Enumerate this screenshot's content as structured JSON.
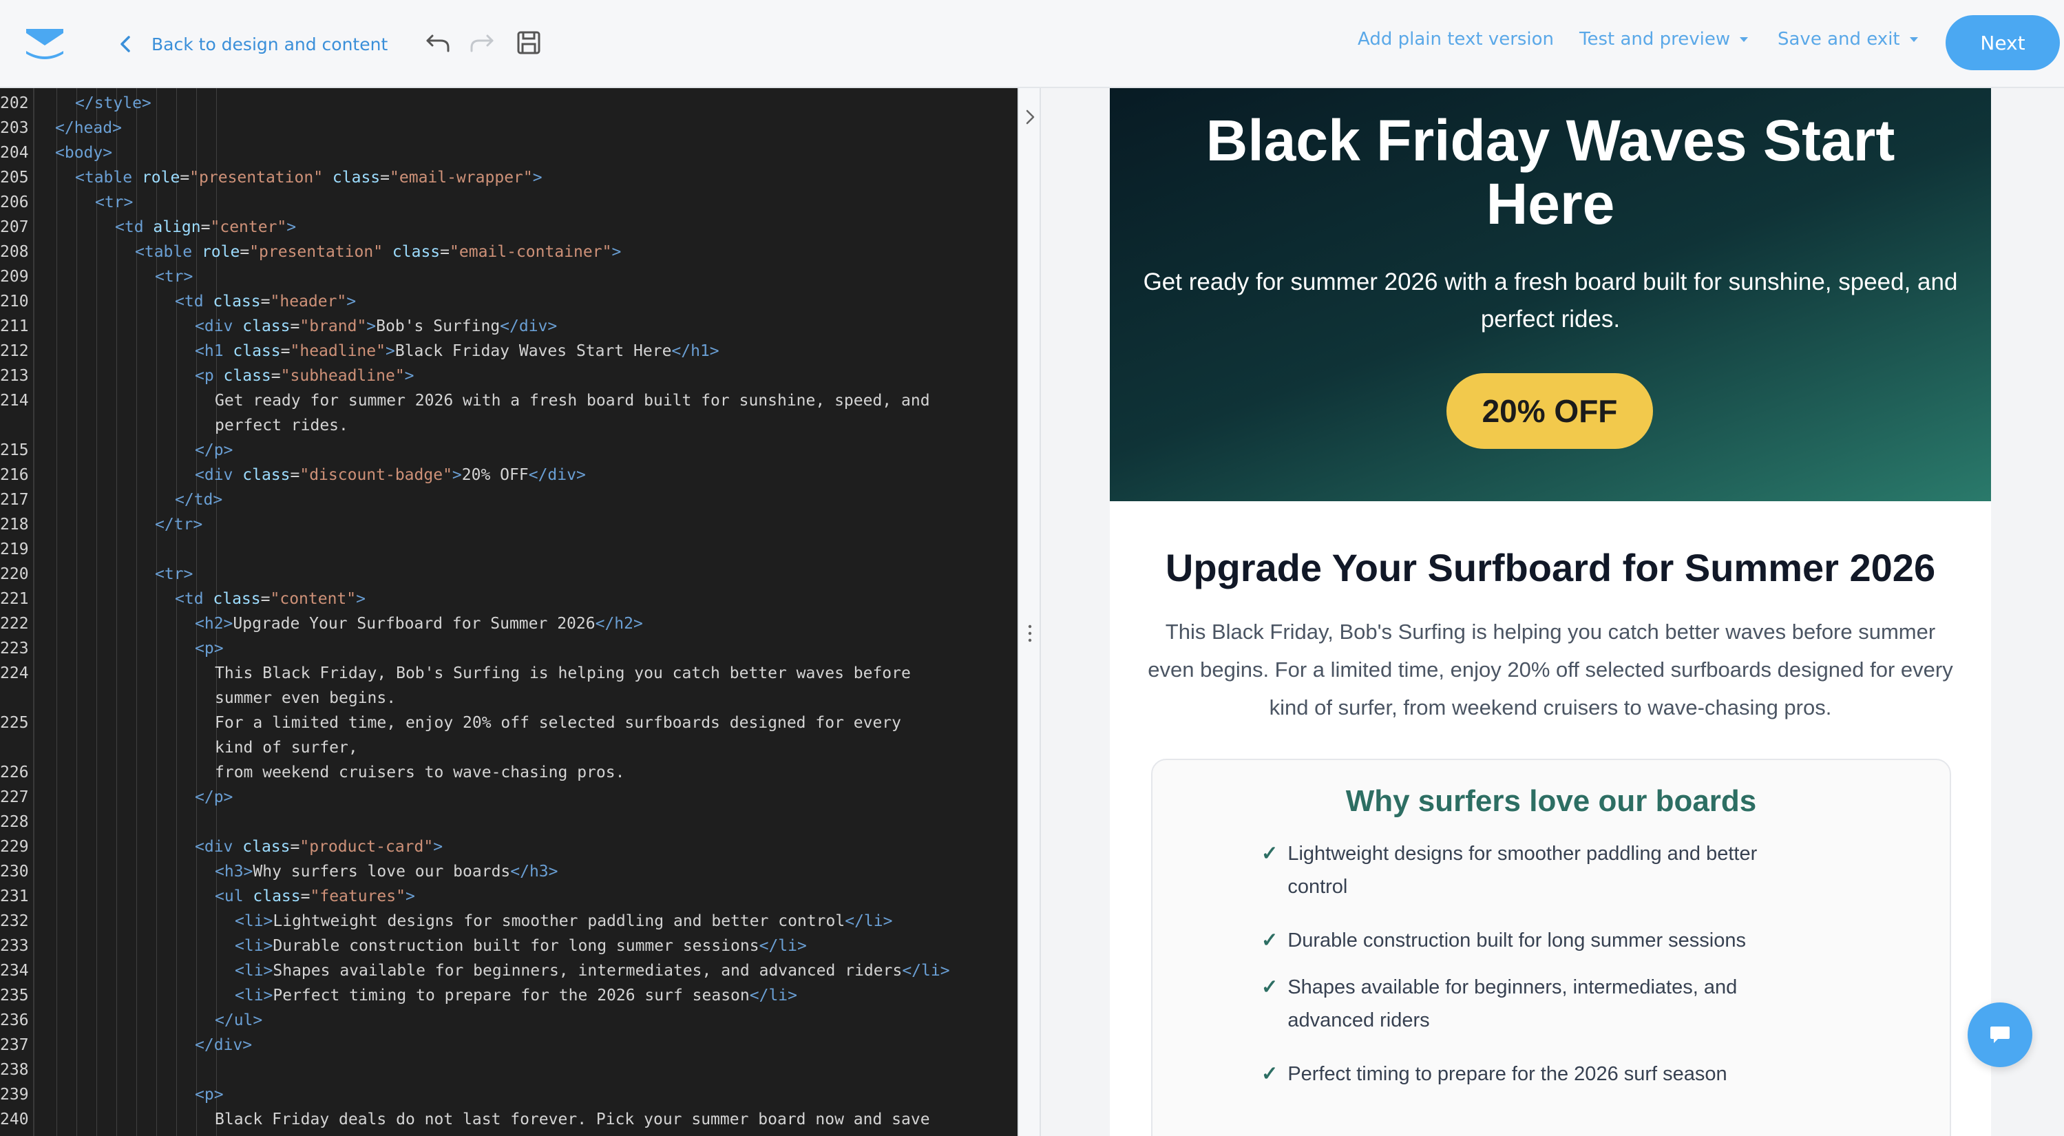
{
  "topbar": {
    "back_label": "Back to design and content",
    "add_plain_text": "Add plain text version",
    "test_preview": "Test and preview",
    "save_exit": "Save and exit",
    "next": "Next"
  },
  "icons": {
    "logo": "envelope-logo-icon",
    "back": "chevron-left-icon",
    "undo": "undo-icon",
    "redo": "redo-icon",
    "save": "save-icon",
    "collapse": "chevron-right-icon",
    "drag": "drag-handle-icon",
    "chat": "chat-icon"
  },
  "colors": {
    "accent": "#4ba8f2",
    "link": "#3a8fd9",
    "badge": "#f2c94c",
    "card_heading": "#2d6e63",
    "editor_bg": "#1e1e1e"
  },
  "editor": {
    "lines": [
      {
        "n": "202",
        "indent": 1,
        "parts": [
          [
            "t",
            "</style>"
          ]
        ]
      },
      {
        "n": "203",
        "indent": 0,
        "parts": [
          [
            "t",
            "</head>"
          ]
        ]
      },
      {
        "n": "204",
        "indent": 0,
        "parts": [
          [
            "t",
            "<body>"
          ]
        ]
      },
      {
        "n": "205",
        "indent": 1,
        "parts": [
          [
            "t",
            "<table "
          ],
          [
            "a",
            "role"
          ],
          [
            "x",
            "="
          ],
          [
            "s",
            "\"presentation\""
          ],
          [
            "x",
            " "
          ],
          [
            "a",
            "class"
          ],
          [
            "x",
            "="
          ],
          [
            "s",
            "\"email-wrapper\""
          ],
          [
            "t",
            ">"
          ]
        ]
      },
      {
        "n": "206",
        "indent": 2,
        "parts": [
          [
            "t",
            "<tr>"
          ]
        ]
      },
      {
        "n": "207",
        "indent": 3,
        "parts": [
          [
            "t",
            "<td "
          ],
          [
            "a",
            "align"
          ],
          [
            "x",
            "="
          ],
          [
            "s",
            "\"center\""
          ],
          [
            "t",
            ">"
          ]
        ]
      },
      {
        "n": "208",
        "indent": 4,
        "parts": [
          [
            "t",
            "<table "
          ],
          [
            "a",
            "role"
          ],
          [
            "x",
            "="
          ],
          [
            "s",
            "\"presentation\""
          ],
          [
            "x",
            " "
          ],
          [
            "a",
            "class"
          ],
          [
            "x",
            "="
          ],
          [
            "s",
            "\"email-container\""
          ],
          [
            "t",
            ">"
          ]
        ]
      },
      {
        "n": "209",
        "indent": 5,
        "parts": [
          [
            "t",
            "<tr>"
          ]
        ]
      },
      {
        "n": "210",
        "indent": 6,
        "parts": [
          [
            "t",
            "<td "
          ],
          [
            "a",
            "class"
          ],
          [
            "x",
            "="
          ],
          [
            "s",
            "\"header\""
          ],
          [
            "t",
            ">"
          ]
        ]
      },
      {
        "n": "211",
        "indent": 7,
        "parts": [
          [
            "t",
            "<div "
          ],
          [
            "a",
            "class"
          ],
          [
            "x",
            "="
          ],
          [
            "s",
            "\"brand\""
          ],
          [
            "t",
            ">"
          ],
          [
            "x",
            "Bob's Surfing"
          ],
          [
            "t",
            "</div>"
          ]
        ]
      },
      {
        "n": "212",
        "indent": 7,
        "parts": [
          [
            "t",
            "<h1 "
          ],
          [
            "a",
            "class"
          ],
          [
            "x",
            "="
          ],
          [
            "s",
            "\"headline\""
          ],
          [
            "t",
            ">"
          ],
          [
            "x",
            "Black Friday Waves Start Here"
          ],
          [
            "t",
            "</h1>"
          ]
        ]
      },
      {
        "n": "213",
        "indent": 7,
        "parts": [
          [
            "t",
            "<p "
          ],
          [
            "a",
            "class"
          ],
          [
            "x",
            "="
          ],
          [
            "s",
            "\"subheadline\""
          ],
          [
            "t",
            ">"
          ]
        ]
      },
      {
        "n": "214",
        "indent": 8,
        "parts": [
          [
            "x",
            "Get ready for summer 2026 with a fresh board built for sunshine, speed, and"
          ]
        ]
      },
      {
        "n": "",
        "indent": 8,
        "parts": [
          [
            "x",
            "perfect rides."
          ]
        ]
      },
      {
        "n": "215",
        "indent": 7,
        "parts": [
          [
            "t",
            "</p>"
          ]
        ]
      },
      {
        "n": "216",
        "indent": 7,
        "parts": [
          [
            "t",
            "<div "
          ],
          [
            "a",
            "class"
          ],
          [
            "x",
            "="
          ],
          [
            "s",
            "\"discount-badge\""
          ],
          [
            "t",
            ">"
          ],
          [
            "x",
            "20% OFF"
          ],
          [
            "t",
            "</div>"
          ]
        ]
      },
      {
        "n": "217",
        "indent": 6,
        "parts": [
          [
            "t",
            "</td>"
          ]
        ]
      },
      {
        "n": "218",
        "indent": 5,
        "parts": [
          [
            "t",
            "</tr>"
          ]
        ]
      },
      {
        "n": "219",
        "indent": 0,
        "parts": []
      },
      {
        "n": "220",
        "indent": 5,
        "parts": [
          [
            "t",
            "<tr>"
          ]
        ]
      },
      {
        "n": "221",
        "indent": 6,
        "parts": [
          [
            "t",
            "<td "
          ],
          [
            "a",
            "class"
          ],
          [
            "x",
            "="
          ],
          [
            "s",
            "\"content\""
          ],
          [
            "t",
            ">"
          ]
        ]
      },
      {
        "n": "222",
        "indent": 7,
        "parts": [
          [
            "t",
            "<h2>"
          ],
          [
            "x",
            "Upgrade Your Surfboard for Summer 2026"
          ],
          [
            "t",
            "</h2>"
          ]
        ]
      },
      {
        "n": "223",
        "indent": 7,
        "parts": [
          [
            "t",
            "<p>"
          ]
        ]
      },
      {
        "n": "224",
        "indent": 8,
        "parts": [
          [
            "x",
            "This Black Friday, Bob's Surfing is helping you catch better waves before"
          ]
        ]
      },
      {
        "n": "",
        "indent": 8,
        "parts": [
          [
            "x",
            "summer even begins."
          ]
        ]
      },
      {
        "n": "225",
        "indent": 8,
        "parts": [
          [
            "x",
            "For a limited time, enjoy 20% off selected surfboards designed for every"
          ]
        ]
      },
      {
        "n": "",
        "indent": 8,
        "parts": [
          [
            "x",
            "kind of surfer,"
          ]
        ]
      },
      {
        "n": "226",
        "indent": 8,
        "parts": [
          [
            "x",
            "from weekend cruisers to wave-chasing pros."
          ]
        ]
      },
      {
        "n": "227",
        "indent": 7,
        "parts": [
          [
            "t",
            "</p>"
          ]
        ]
      },
      {
        "n": "228",
        "indent": 0,
        "parts": []
      },
      {
        "n": "229",
        "indent": 7,
        "parts": [
          [
            "t",
            "<div "
          ],
          [
            "a",
            "class"
          ],
          [
            "x",
            "="
          ],
          [
            "s",
            "\"product-card\""
          ],
          [
            "t",
            ">"
          ]
        ]
      },
      {
        "n": "230",
        "indent": 8,
        "parts": [
          [
            "t",
            "<h3>"
          ],
          [
            "x",
            "Why surfers love our boards"
          ],
          [
            "t",
            "</h3>"
          ]
        ]
      },
      {
        "n": "231",
        "indent": 8,
        "parts": [
          [
            "t",
            "<ul "
          ],
          [
            "a",
            "class"
          ],
          [
            "x",
            "="
          ],
          [
            "s",
            "\"features\""
          ],
          [
            "t",
            ">"
          ]
        ]
      },
      {
        "n": "232",
        "indent": 9,
        "parts": [
          [
            "t",
            "<li>"
          ],
          [
            "x",
            "Lightweight designs for smoother paddling and better control"
          ],
          [
            "t",
            "</li>"
          ]
        ]
      },
      {
        "n": "233",
        "indent": 9,
        "parts": [
          [
            "t",
            "<li>"
          ],
          [
            "x",
            "Durable construction built for long summer sessions"
          ],
          [
            "t",
            "</li>"
          ]
        ]
      },
      {
        "n": "234",
        "indent": 9,
        "parts": [
          [
            "t",
            "<li>"
          ],
          [
            "x",
            "Shapes available for beginners, intermediates, and advanced riders"
          ],
          [
            "t",
            "</li>"
          ]
        ]
      },
      {
        "n": "235",
        "indent": 9,
        "parts": [
          [
            "t",
            "<li>"
          ],
          [
            "x",
            "Perfect timing to prepare for the 2026 surf season"
          ],
          [
            "t",
            "</li>"
          ]
        ]
      },
      {
        "n": "236",
        "indent": 8,
        "parts": [
          [
            "t",
            "</ul>"
          ]
        ]
      },
      {
        "n": "237",
        "indent": 7,
        "parts": [
          [
            "t",
            "</div>"
          ]
        ]
      },
      {
        "n": "238",
        "indent": 0,
        "parts": []
      },
      {
        "n": "239",
        "indent": 7,
        "parts": [
          [
            "t",
            "<p>"
          ]
        ]
      },
      {
        "n": "240",
        "indent": 8,
        "parts": [
          [
            "x",
            "Black Friday deals do not last forever. Pick your summer board now and save"
          ]
        ]
      }
    ]
  },
  "preview": {
    "hero_title": "Black Friday Waves Start Here",
    "hero_sub": "Get ready for summer 2026 with a fresh board built for sunshine, speed, and perfect rides.",
    "badge": "20% OFF",
    "h2": "Upgrade Your Surfboard for Summer 2026",
    "intro": "This Black Friday, Bob's Surfing is helping you catch better waves before summer even begins. For a limited time, enjoy 20% off selected surfboards designed for every kind of surfer, from weekend cruisers to wave-chasing pros.",
    "card_title": "Why surfers love our boards",
    "check_mark": "✓",
    "features": [
      "Lightweight designs for smoother paddling and better control",
      "Durable construction built for long summer sessions",
      "Shapes available for beginners, intermediates, and advanced riders",
      "Perfect timing to prepare for the 2026 surf season"
    ]
  }
}
